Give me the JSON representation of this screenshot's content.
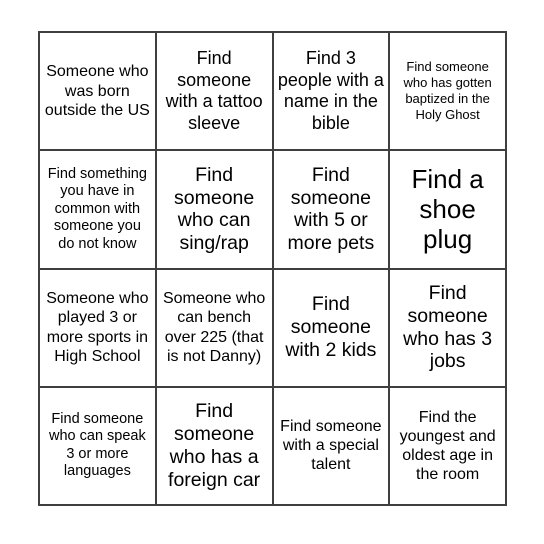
{
  "card": {
    "rows": 4,
    "columns": 4,
    "background_color": "#ffffff",
    "border_color": "#3f3f3f",
    "text_color": "#000000",
    "cells": [
      {
        "text": "Someone who was born outside the US",
        "size": "md"
      },
      {
        "text": "Find someone with a tattoo sleeve",
        "size": "lg"
      },
      {
        "text": "Find 3 people with a name in the bible",
        "size": "lg"
      },
      {
        "text": "Find someone who has gotten baptized in the Holy Ghost",
        "size": "xs"
      },
      {
        "text": "Find something you have in common with someone you do not know",
        "size": "sm"
      },
      {
        "text": "Find someone who can sing/rap",
        "size": "xl"
      },
      {
        "text": "Find someone with 5 or more pets",
        "size": "xl"
      },
      {
        "text": "Find a shoe plug",
        "size": "xxl"
      },
      {
        "text": "Someone who played 3 or more sports in High School",
        "size": "md"
      },
      {
        "text": "Someone who can bench over 225 (that is not Danny)",
        "size": "md"
      },
      {
        "text": "Find someone with 2 kids",
        "size": "xl"
      },
      {
        "text": "Find someone who has 3 jobs",
        "size": "xl"
      },
      {
        "text": "Find someone who can speak 3 or more languages",
        "size": "sm"
      },
      {
        "text": "Find someone who has a foreign car",
        "size": "xl"
      },
      {
        "text": "Find someone with a special talent",
        "size": "md"
      },
      {
        "text": "Find the youngest and oldest age in the room",
        "size": "md"
      }
    ]
  }
}
